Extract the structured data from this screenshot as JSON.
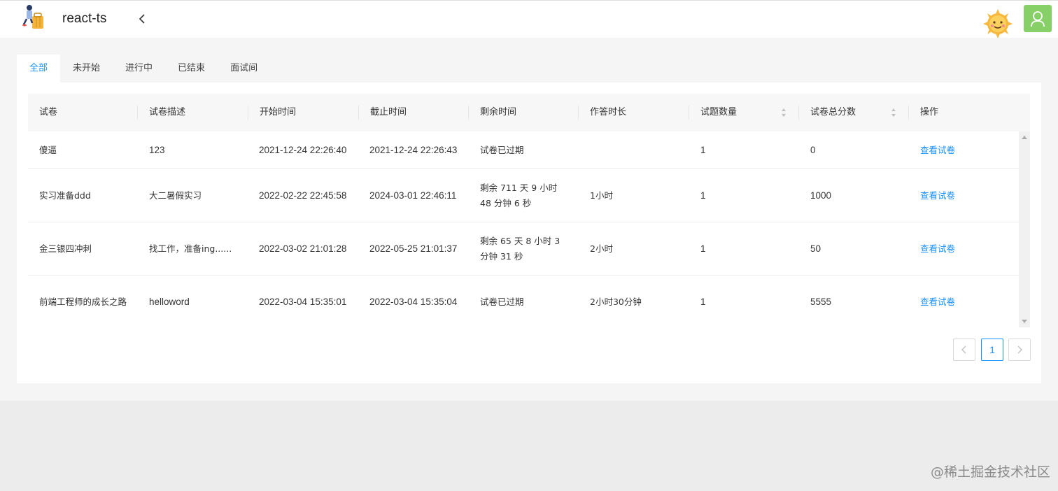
{
  "header": {
    "app_title": "react-ts",
    "collapse_icon": "chevron-left-icon",
    "avatar_icon": "user-icon",
    "avatar_color": "#87d068"
  },
  "tabs": [
    {
      "label": "全部",
      "active": true
    },
    {
      "label": "未开始",
      "active": false
    },
    {
      "label": "进行中",
      "active": false
    },
    {
      "label": "已结束",
      "active": false
    },
    {
      "label": "面试间",
      "active": false
    }
  ],
  "table": {
    "columns": [
      "试卷",
      "试卷描述",
      "开始时间",
      "截止时间",
      "剩余时间",
      "作答时长",
      "试题数量",
      "试卷总分数",
      "操作"
    ],
    "rows": [
      {
        "name": "傻逼",
        "desc": "123",
        "start": "2021-12-24 22:26:40",
        "end": "2021-12-24 22:26:43",
        "remaining": "试卷已过期",
        "duration": "",
        "count": "1",
        "score": "0",
        "action": "查看试卷"
      },
      {
        "name": "实习准备ddd",
        "desc": "大二暑假实习",
        "start": "2022-02-22 22:45:58",
        "end": "2024-03-01 22:46:11",
        "remaining": "剩余 711 天 9 小时 48 分钟 6 秒",
        "duration": "1小时",
        "count": "1",
        "score": "1000",
        "action": "查看试卷"
      },
      {
        "name": "金三银四冲刺",
        "desc": "找工作，准备ing......",
        "start": "2022-03-02 21:01:28",
        "end": "2022-05-25 21:01:37",
        "remaining": "剩余 65 天 8 小时 3 分钟 31 秒",
        "duration": "2小时",
        "count": "1",
        "score": "50",
        "action": "查看试卷"
      },
      {
        "name": "前端工程师的成长之路",
        "desc": "helloword",
        "start": "2022-03-04 15:35:01",
        "end": "2022-03-04 15:35:04",
        "remaining": "试卷已过期",
        "duration": "2小时30分钟",
        "count": "1",
        "score": "5555",
        "action": "查看试卷"
      }
    ]
  },
  "pagination": {
    "current": "1",
    "prev_icon": "chevron-left-icon",
    "next_icon": "chevron-right-icon"
  },
  "watermark": "@稀土掘金技术社区",
  "colors": {
    "primary": "#1890ff",
    "header_bg": "#fafafa"
  }
}
